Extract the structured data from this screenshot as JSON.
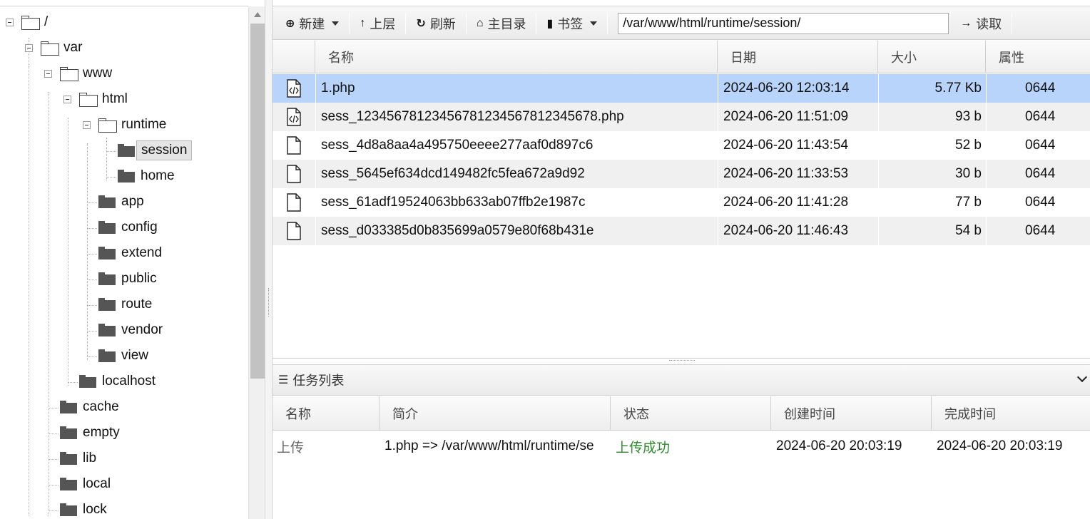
{
  "tree": {
    "root": "/",
    "nodes": [
      "var",
      "www",
      "html",
      "runtime",
      "session",
      "home",
      "app",
      "config",
      "extend",
      "public",
      "route",
      "vendor",
      "view",
      "localhost",
      "cache",
      "empty",
      "lib",
      "local",
      "lock"
    ]
  },
  "toolbar": {
    "new_label": "新建",
    "up_label": "上层",
    "refresh_label": "刷新",
    "home_label": "主目录",
    "bookmark_label": "书签",
    "path_value": "/var/www/html/runtime/session/",
    "read_label": "读取"
  },
  "files": {
    "columns": [
      "名称",
      "日期",
      "大小",
      "属性"
    ],
    "rows": [
      {
        "name": "1.php",
        "date": "2024-06-20 12:03:14",
        "size": "5.77 Kb",
        "attr": "0644",
        "icon": "code-file-icon"
      },
      {
        "name": "sess_12345678123456781234567812345678.php",
        "date": "2024-06-20 11:51:09",
        "size": "93 b",
        "attr": "0644",
        "icon": "code-file-icon"
      },
      {
        "name": "sess_4d8a8aa4a495750eeee277aaf0d897c6",
        "date": "2024-06-20 11:43:54",
        "size": "52 b",
        "attr": "0644",
        "icon": "file-icon"
      },
      {
        "name": "sess_5645ef634dcd149482fc5fea672a9d92",
        "date": "2024-06-20 11:33:53",
        "size": "30 b",
        "attr": "0644",
        "icon": "file-icon"
      },
      {
        "name": "sess_61adf19524063bb633ab07ffb2e1987c",
        "date": "2024-06-20 11:41:28",
        "size": "77 b",
        "attr": "0644",
        "icon": "file-icon"
      },
      {
        "name": "sess_d033385d0b835699a0579e80f68b431e",
        "date": "2024-06-20 11:46:43",
        "size": "54 b",
        "attr": "0644",
        "icon": "file-icon"
      }
    ]
  },
  "tasks": {
    "title": "任务列表",
    "columns": [
      "名称",
      "简介",
      "状态",
      "创建时间",
      "完成时间"
    ],
    "rows": [
      {
        "name": "上传",
        "desc": "1.php => /var/www/html/runtime/se",
        "status": "上传成功",
        "created": "2024-06-20 20:03:19",
        "finished": "2024-06-20 20:03:19"
      }
    ],
    "status_color": "#2e8b2e"
  },
  "colors": {
    "selected_row": "#b9d4fb",
    "alt_row": "#f0f0f0"
  }
}
